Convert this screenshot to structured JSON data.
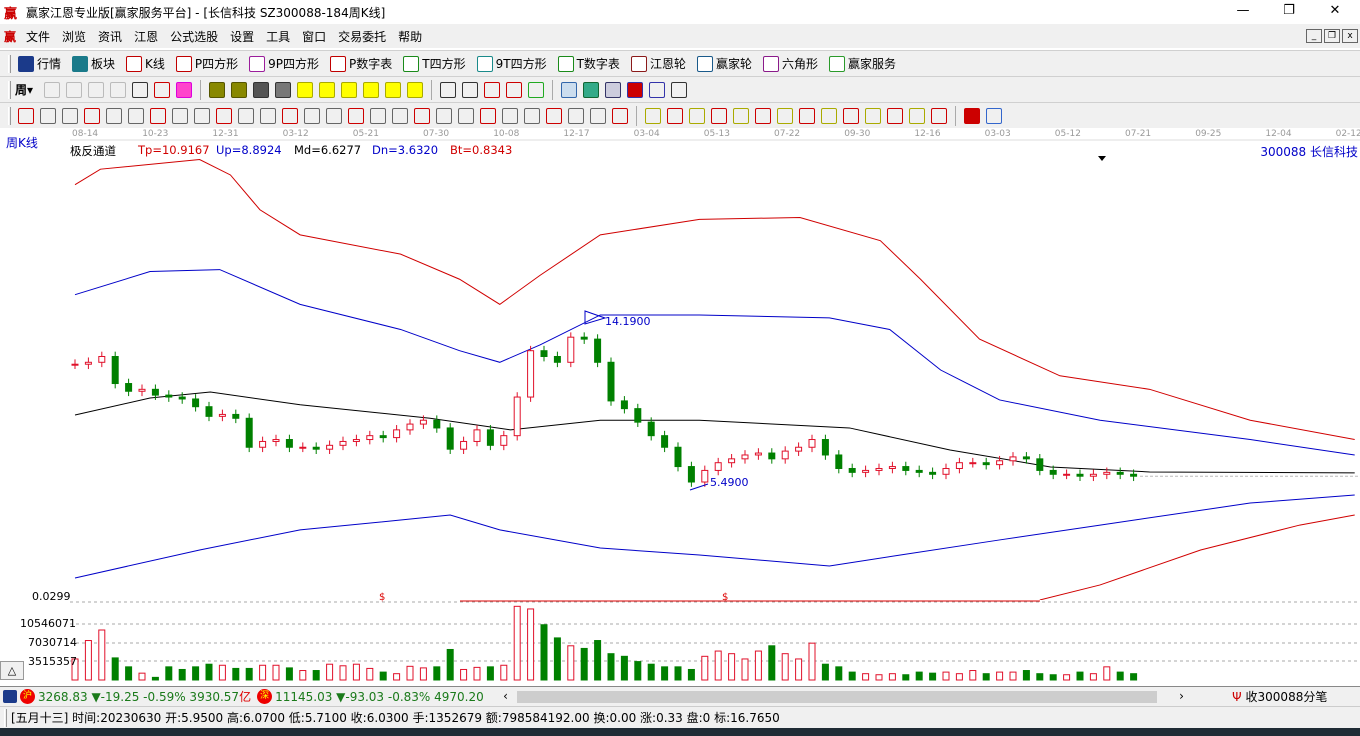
{
  "title_bar": {
    "title": "赢家江恩专业版[赢家服务平台] - [长信科技  SZ300088-184周K线]",
    "minimize": "—",
    "restore": "❐",
    "close": "✕"
  },
  "menu": [
    "文件",
    "浏览",
    "资讯",
    "江恩",
    "公式选股",
    "设置",
    "工具",
    "窗口",
    "交易委托",
    "帮助"
  ],
  "toolbar1": [
    {
      "label": "行情",
      "icon": "quote-table-icon",
      "color": "#1b3a8a"
    },
    {
      "label": "板块",
      "icon": "sector-grid-icon",
      "color": "#1a7a8a"
    },
    {
      "label": "K线",
      "icon": "kline-icon",
      "color": "#c00000"
    },
    {
      "label": "P四方形",
      "icon": "ps-icon",
      "color": "#c00000"
    },
    {
      "label": "9P四方形",
      "icon": "p9-icon",
      "color": "#9b1d9b"
    },
    {
      "label": "P数字表",
      "icon": "pn-icon",
      "color": "#c00000"
    },
    {
      "label": "T四方形",
      "icon": "ts-icon",
      "color": "#1a8a1a"
    },
    {
      "label": "9T四方形",
      "icon": "t9-icon",
      "color": "#1a8a8a"
    },
    {
      "label": "T数字表",
      "icon": "tn-icon",
      "color": "#1a8a1a"
    },
    {
      "label": "江恩轮",
      "icon": "gann-wheel-icon",
      "color": "#8b1a1a"
    },
    {
      "label": "赢家轮",
      "icon": "winner-wheel-icon",
      "color": "#1a5a8a"
    },
    {
      "label": "六角形",
      "icon": "hexagon-icon",
      "color": "#8a1a8a"
    },
    {
      "label": "赢家服务",
      "icon": "dollar-icon",
      "color": "#2a9a2a"
    }
  ],
  "toolbar2": {
    "period": "周"
  },
  "chart": {
    "period_label": "周K线",
    "indicator_name": "极反通道",
    "params": [
      {
        "text": "Tp=10.9167",
        "color": "#d00000"
      },
      {
        "text": "Up=8.8924",
        "color": "#0000c8"
      },
      {
        "text": "Md=6.6277",
        "color": "#000000"
      },
      {
        "text": "Dn=3.6320",
        "color": "#0000c8"
      },
      {
        "text": "Bt=0.8343",
        "color": "#d00000"
      }
    ],
    "stock": "300088 长信科技",
    "high_marker": "14.1900",
    "low_marker": "5.4900",
    "dates": [
      "08-14",
      "10-23",
      "12-31",
      "03-12",
      "05-21",
      "07-30",
      "10-08",
      "12-17",
      "03-04",
      "05-13",
      "07-22",
      "09-30",
      "12-16",
      "03-03",
      "05-12",
      "07-21",
      "09-25",
      "12-04",
      "02-12"
    ],
    "vol_indicator_label": "0.0299",
    "vol_axis": [
      "10546071",
      "7030714",
      "3515357"
    ]
  },
  "chart_data": {
    "type": "candlestick",
    "title": "SZ300088 长信科技 周K线 极反通道",
    "closes": [
      11.9,
      12.0,
      12.3,
      10.9,
      10.5,
      10.6,
      10.3,
      10.2,
      10.1,
      9.7,
      9.2,
      9.3,
      9.1,
      7.6,
      7.9,
      8.0,
      7.6,
      7.6,
      7.5,
      7.7,
      7.9,
      8.0,
      8.2,
      8.1,
      8.5,
      8.8,
      9.0,
      8.6,
      7.5,
      7.9,
      8.5,
      7.7,
      8.2,
      10.2,
      12.6,
      12.3,
      12.0,
      13.3,
      13.2,
      12.0,
      10.0,
      9.6,
      8.9,
      8.2,
      7.6,
      6.6,
      5.8,
      6.4,
      6.8,
      7.0,
      7.2,
      7.3,
      7.0,
      7.4,
      7.6,
      8.0,
      7.2,
      6.5,
      6.3,
      6.4,
      6.5,
      6.6,
      6.4,
      6.3,
      6.2,
      6.5,
      6.8,
      6.8,
      6.7,
      6.9,
      7.1,
      7.0,
      6.4,
      6.2,
      6.2,
      6.1,
      6.2,
      6.3,
      6.2,
      6.1
    ],
    "volumes": [
      4.0,
      7.5,
      9.5,
      4.2,
      2.5,
      1.3,
      0.5,
      2.5,
      2.0,
      2.5,
      3.0,
      2.8,
      2.2,
      2.2,
      2.8,
      2.8,
      2.3,
      1.8,
      1.8,
      3.0,
      2.7,
      3.0,
      2.2,
      1.5,
      1.2,
      2.6,
      2.3,
      2.5,
      5.8,
      2.0,
      2.4,
      2.5,
      2.8,
      14.0,
      13.5,
      10.5,
      8.0,
      6.5,
      6.0,
      7.5,
      5.0,
      4.5,
      3.5,
      3.0,
      2.5,
      2.5,
      2.0,
      4.5,
      5.5,
      5.0,
      4.0,
      5.5,
      6.5,
      5.0,
      4.0,
      7.0,
      3.0,
      2.5,
      1.5,
      1.2,
      1.0,
      1.2,
      1.0,
      1.5,
      1.3,
      1.5,
      1.2,
      1.8,
      1.2,
      1.5,
      1.5,
      1.8,
      1.2,
      1.0,
      1.0,
      1.5,
      1.2,
      2.5,
      1.5,
      1.2
    ],
    "volume_unit": "million",
    "bands": [
      {
        "name": "Tp",
        "color": "#d00000",
        "points": [
          [
            0,
            21.2
          ],
          [
            1.9,
            22.0
          ],
          [
            9.3,
            22.5
          ],
          [
            11.6,
            21.7
          ],
          [
            13.8,
            19.9
          ],
          [
            16.8,
            18.6
          ],
          [
            24.3,
            17.6
          ],
          [
            28.7,
            16.3
          ],
          [
            31.7,
            15.0
          ],
          [
            34.7,
            16.5
          ],
          [
            39.2,
            18.6
          ],
          [
            46.6,
            19.4
          ],
          [
            54.1,
            19.5
          ],
          [
            60.1,
            18.3
          ],
          [
            63.1,
            16.3
          ],
          [
            67.5,
            13.2
          ],
          [
            73.5,
            11.3
          ],
          [
            80.2,
            10.6
          ],
          [
            87.7,
            9.0
          ],
          [
            95.5,
            8.0
          ]
        ]
      },
      {
        "name": "Up",
        "color": "#0000c8",
        "points": [
          [
            0,
            15.5
          ],
          [
            5.6,
            16.7
          ],
          [
            10.8,
            16.8
          ],
          [
            16.8,
            15.0
          ],
          [
            24.3,
            13.7
          ],
          [
            28.7,
            12.6
          ],
          [
            31.7,
            12.0
          ],
          [
            34.7,
            12.9
          ],
          [
            39.2,
            14.45
          ],
          [
            46.6,
            14.45
          ],
          [
            56.3,
            14.3
          ],
          [
            60.8,
            13.7
          ],
          [
            64.6,
            11.6
          ],
          [
            69.0,
            10.05
          ],
          [
            76.5,
            9.0
          ],
          [
            87.7,
            8.0
          ],
          [
            95.5,
            7.2
          ]
        ]
      },
      {
        "name": "Md",
        "color": "#000000",
        "points": [
          [
            0,
            9.27
          ],
          [
            5.6,
            10.15
          ],
          [
            10.1,
            10.46
          ],
          [
            16.8,
            9.8
          ],
          [
            26.5,
            9.1
          ],
          [
            32.5,
            8.5
          ],
          [
            39.2,
            9.0
          ],
          [
            46.6,
            9.0
          ],
          [
            57.8,
            8.6
          ],
          [
            65.3,
            7.46
          ],
          [
            72.8,
            6.58
          ],
          [
            80.2,
            6.32
          ],
          [
            95.5,
            6.27
          ]
        ]
      },
      {
        "name": "Dn",
        "color": "#0000c8",
        "points": [
          [
            0,
            0.83
          ],
          [
            9.3,
            2.28
          ],
          [
            16.8,
            3.32
          ],
          [
            24.3,
            3.83
          ],
          [
            28,
            4.09
          ],
          [
            31.7,
            3.32
          ],
          [
            39.2,
            2.38
          ],
          [
            46.6,
            2.02
          ],
          [
            56.3,
            1.45
          ],
          [
            61.6,
            2.02
          ],
          [
            69,
            2.8
          ],
          [
            76.5,
            3.57
          ],
          [
            87.7,
            4.71
          ],
          [
            95.5,
            5.13
          ]
        ]
      },
      {
        "name": "Bt",
        "color": "#d00000",
        "points": [
          [
            72,
            -0.31
          ],
          [
            76.5,
            0.47
          ],
          [
            84,
            2.28
          ],
          [
            91.4,
            3.57
          ],
          [
            95.5,
            4.09
          ]
        ]
      }
    ]
  },
  "index_bar": {
    "sh_badge": "沪",
    "sh": "3268.83 ▼-19.25 -0.59% 3930.57",
    "sh_unit": "亿",
    "sz_badge": "深",
    "sz": "11145.03 ▼-93.03 -0.83% 4970.20",
    "scroll_left": "‹",
    "scroll_right": "›",
    "receive": "收300088分笔"
  },
  "status_bar": {
    "text": "[五月十三] 时间:20230630 开:5.9500 高:6.0700 低:5.7100 收:6.0300 手:1352679 额:798584192.00 换:0.00 涨:0.33 盘:0 标:16.7650"
  },
  "collapse_button": "△"
}
